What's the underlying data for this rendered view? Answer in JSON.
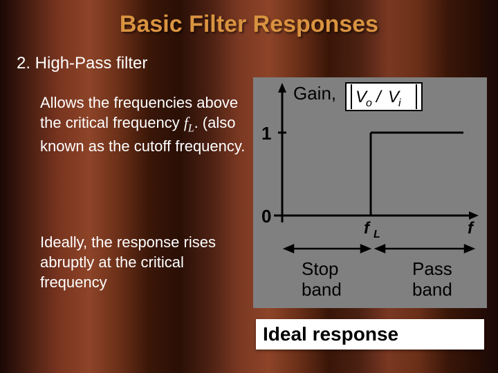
{
  "title": "Basic Filter Responses",
  "subhead": "2. High-Pass filter",
  "para1_a": "Allows the frequencies above the critical frequency ",
  "para1_fL": "f",
  "para1_fL_sub": "L",
  "para1_b": ". (also known as the cutoff frequency.",
  "para2": "Ideally, the response rises abruptly at the critical frequency",
  "graph": {
    "gain_label": "Gain,",
    "ratio_Vo": "V",
    "ratio_o": "o",
    "ratio_slash": "/",
    "ratio_Vi": "V",
    "ratio_i": "i",
    "y1": "1",
    "y0": "0",
    "fL": "f",
    "fL_sub": "L",
    "f_axis": "f",
    "stop1": "Stop",
    "stop2": "band",
    "pass1": "Pass",
    "pass2": "band"
  },
  "caption": "Ideal response",
  "chart_data": {
    "type": "line",
    "title": "Ideal High-Pass Filter Response",
    "xlabel": "f",
    "ylabel": "Gain, |Vo/Vi|",
    "x": [
      "0",
      "fL-",
      "fL+",
      "f→∞"
    ],
    "values": [
      0,
      0,
      1,
      1
    ],
    "ylim": [
      0,
      1
    ],
    "annotations": [
      "Stop band (f < fL)",
      "Pass band (f > fL)"
    ]
  }
}
